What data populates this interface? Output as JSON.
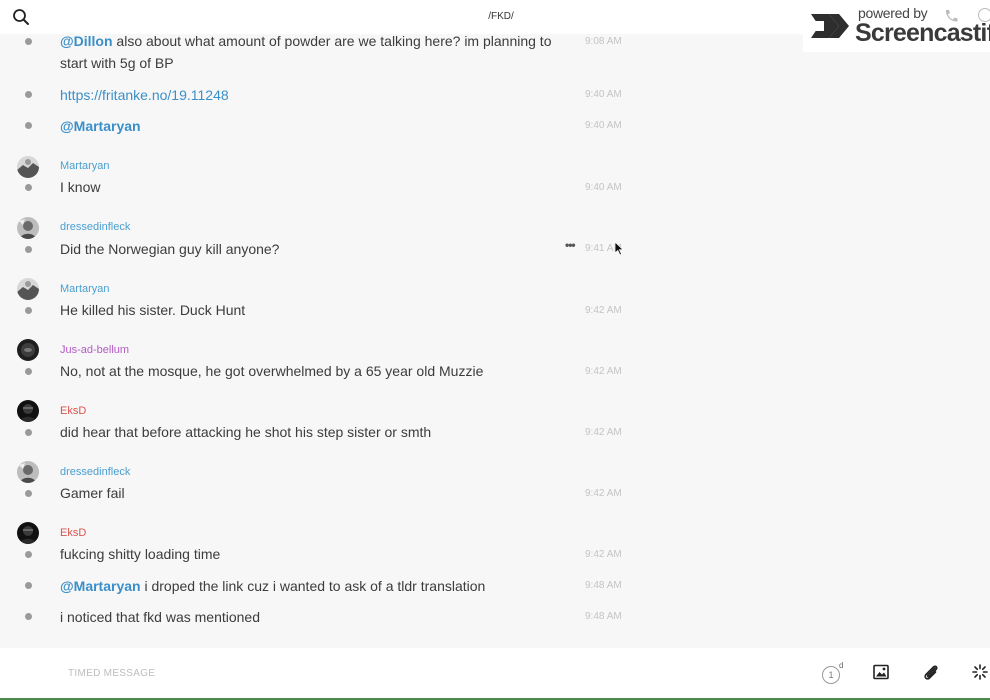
{
  "header": {
    "channel": "/FKD/",
    "search_icon": "search-icon"
  },
  "watermark": {
    "powered_by": "powered by",
    "brand": "Screencastify"
  },
  "messages": [
    {
      "type": "continuation",
      "mention": "@Dillon",
      "text": " also about what amount of powder are we talking here? im planning to start with 5g of BP",
      "time": "9:08 AM"
    },
    {
      "type": "link",
      "text": "https://fritanke.no/19.11248",
      "time": "9:40 AM"
    },
    {
      "type": "continuation",
      "mention": "@Martaryan",
      "text": "",
      "time": "9:40 AM"
    },
    {
      "type": "group",
      "author": "Martaryan",
      "author_color": "#4a9fd1",
      "text": "I know",
      "time": "9:40 AM"
    },
    {
      "type": "group",
      "author": "dressedinfleck",
      "author_color": "#4a9fd1",
      "text": "Did the Norwegian guy kill anyone?",
      "time": "9:41 AM"
    },
    {
      "type": "group",
      "author": "Martaryan",
      "author_color": "#4a9fd1",
      "text": "He killed his sister. Duck Hunt",
      "time": "9:42 AM"
    },
    {
      "type": "group",
      "author": "Jus-ad-bellum",
      "author_color": "#b25cc7",
      "text": "No, not at the mosque, he got overwhelmed by a 65 year old Muzzie",
      "time": "9:42 AM"
    },
    {
      "type": "group",
      "author": "EksD",
      "author_color": "#d9534f",
      "text": "did hear that before attacking he shot his step sister or smth",
      "time": "9:42 AM"
    },
    {
      "type": "group",
      "author": "dressedinfleck",
      "author_color": "#4a9fd1",
      "text": "Gamer fail",
      "time": "9:42 AM"
    },
    {
      "type": "group",
      "author": "EksD",
      "author_color": "#d9534f",
      "text": "fukcing shitty loading time",
      "time": "9:42 AM"
    },
    {
      "type": "continuation",
      "mention": "@Martaryan",
      "text": " i droped the link cuz i wanted to ask of a tldr translation",
      "time": "9:48 AM"
    },
    {
      "type": "continuation",
      "mention": "",
      "text": "i noticed that fkd was mentioned",
      "time": "9:48 AM"
    }
  ],
  "composer": {
    "placeholder": "TIMED MESSAGE",
    "timer_value": "1",
    "timer_unit": "d"
  },
  "colors": {
    "mention": "#3a8fc9",
    "bullet": "#9a9a9a",
    "time": "#c4c4c4"
  }
}
